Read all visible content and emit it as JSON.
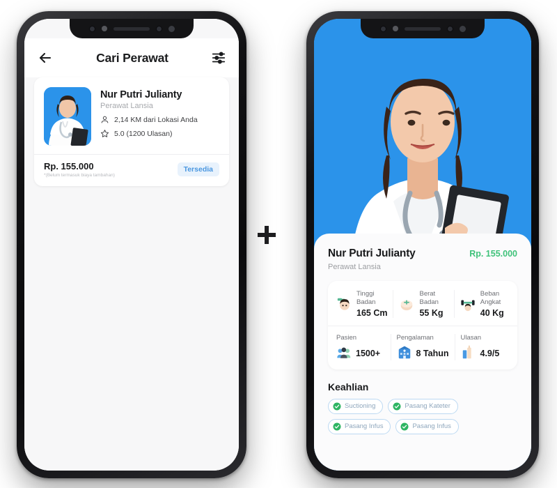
{
  "left_phone": {
    "header": {
      "back_icon": "arrow-left-icon",
      "title": "Cari Perawat",
      "filter_icon": "sliders-filter-icon"
    },
    "card": {
      "avatar": "nurse-photo",
      "name": "Nur Putri Julianty",
      "role": "Perawat Lansia",
      "distance_icon": "location-pin-icon",
      "distance": "2,14 KM dari Lokasi Anda",
      "rating_icon": "star-icon",
      "rating": "5.0 (1200 Ulasan)",
      "price": "Rp. 155.000",
      "price_note": "*(Belum termasuk biaya tambahan)",
      "status_badge": "Tersedia"
    }
  },
  "right_phone": {
    "hero": {
      "image": "nurse-portrait-photo",
      "background_color": "#2b93ea"
    },
    "detail": {
      "name": "Nur Putri Julianty",
      "price": "Rp. 155.000",
      "price_color": "#3fc27a",
      "role": "Perawat Lansia",
      "stats_row1": [
        {
          "icon": "height-person-icon",
          "label": "Tinggi Badan",
          "value": "165 Cm"
        },
        {
          "icon": "weight-scale-icon",
          "label": "Berat Badan",
          "value": "55 Kg"
        },
        {
          "icon": "dumbbell-icon",
          "label": "Beban Angkat",
          "value": "40 Kg"
        }
      ],
      "stats_row2": [
        {
          "icon": "people-icon",
          "label": "Pasien",
          "value": "1500+"
        },
        {
          "icon": "hospital-icon",
          "label": "Pengalaman",
          "value": "8 Tahun"
        },
        {
          "icon": "rating-bars-icon",
          "label": "Ulasan",
          "value": "4.9/5"
        }
      ],
      "skills_title": "Keahlian",
      "skills": [
        {
          "icon": "check-circle-icon",
          "label": "Suctioning"
        },
        {
          "icon": "check-circle-icon",
          "label": "Pasang Kateter"
        },
        {
          "icon": "check-circle-icon",
          "label": "Pasang Infus"
        },
        {
          "icon": "check-circle-icon",
          "label": "Pasang Infus"
        }
      ]
    }
  },
  "decoration": {
    "plus_icon": "plus-icon"
  }
}
